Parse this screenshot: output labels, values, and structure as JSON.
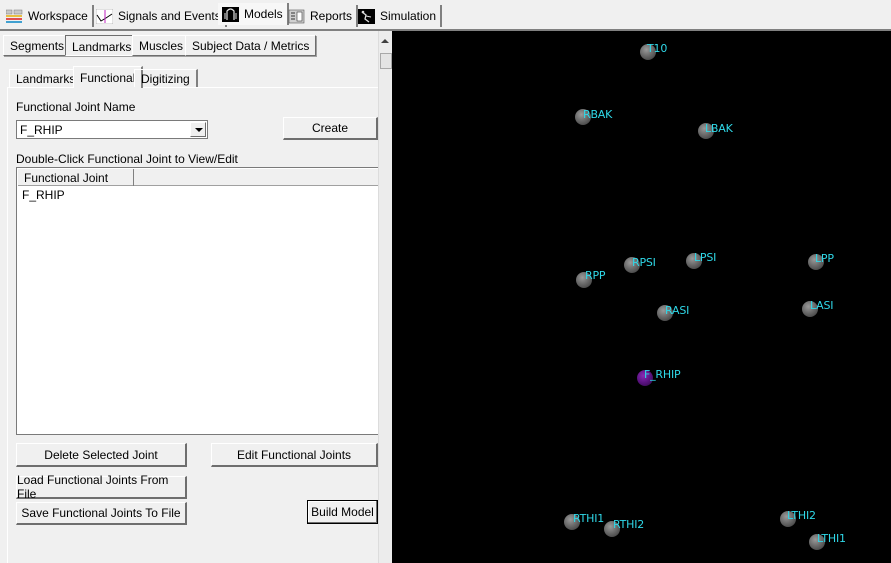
{
  "top_tabs": [
    {
      "label": "Workspace",
      "icon": "workspace-icon",
      "active": false
    },
    {
      "label": "Signals and Events",
      "icon": "signals-icon",
      "active": false
    },
    {
      "label": "Models",
      "icon": "models-icon",
      "active": true
    },
    {
      "label": "Reports",
      "icon": "reports-icon",
      "active": false
    },
    {
      "label": "Simulation",
      "icon": "simulation-icon",
      "active": false
    }
  ],
  "model_tabs": [
    {
      "label": "Segments",
      "active": false
    },
    {
      "label": "Landmarks",
      "active": true
    },
    {
      "label": "Muscles",
      "active": false
    },
    {
      "label": "Subject Data / Metrics",
      "active": false
    }
  ],
  "landmark_tabs": [
    {
      "label": "Landmarks",
      "active": false
    },
    {
      "label": "Functional",
      "active": true
    },
    {
      "label": "Digitizing",
      "active": false
    }
  ],
  "functional": {
    "joint_name_label": "Functional Joint Name",
    "joint_name_value": "F_RHIP",
    "create_label": "Create",
    "list_label": "Double-Click Functional Joint to View/Edit",
    "list_columns": [
      "Functional Joint",
      ""
    ],
    "list_rows": [
      "F_RHIP"
    ],
    "delete_label": "Delete Selected Joint",
    "edit_label": "Edit Functional Joints",
    "load_label": "Load Functional Joints From File",
    "save_label": "Save Functional Joints To File",
    "build_label": "Build Model"
  },
  "viewport": {
    "background": "#000000",
    "label_color": "#2fd8e8",
    "markers": [
      {
        "name": "T10"
      },
      {
        "name": "RBAK"
      },
      {
        "name": "LBAK"
      },
      {
        "name": "RPP"
      },
      {
        "name": "RPSI"
      },
      {
        "name": "LPSI"
      },
      {
        "name": "LPP"
      },
      {
        "name": "RASI"
      },
      {
        "name": "LASI"
      },
      {
        "name": "F_RHIP"
      },
      {
        "name": "RTHI1"
      },
      {
        "name": "RTHI2"
      },
      {
        "name": "LTHI2"
      },
      {
        "name": "LTHI1"
      }
    ]
  }
}
